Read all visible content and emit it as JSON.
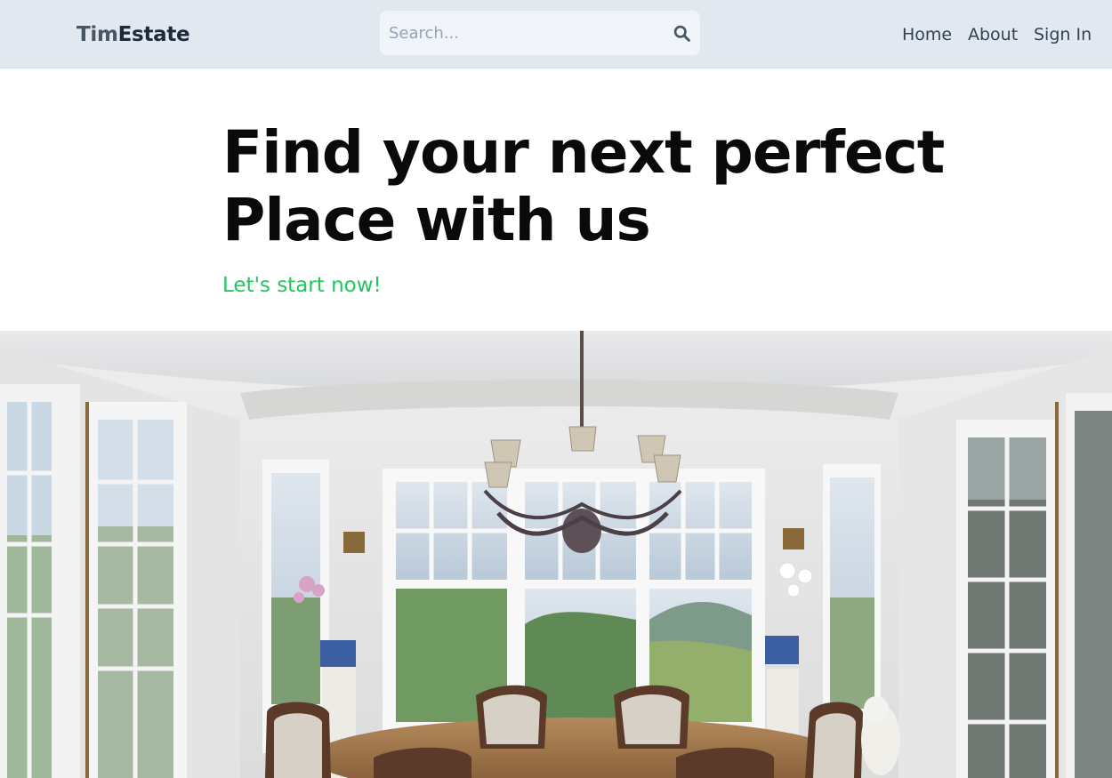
{
  "header": {
    "logo": {
      "part1": "Tim",
      "part2": "Estate"
    },
    "search": {
      "placeholder": "Search..."
    },
    "nav": {
      "home": "Home",
      "about": "About",
      "sign_in": "Sign In"
    }
  },
  "hero": {
    "title_line1": "Find your next perfect",
    "title_line2": "Place with us",
    "subtitle": "Let's start now!"
  },
  "colors": {
    "header_bg": "#e2e8f0",
    "accent_green": "#22c55e",
    "title": "#0a0a0a"
  },
  "icons": {
    "search": "search-icon"
  },
  "image": {
    "subject": "bright dining room with chandelier and large windows"
  }
}
